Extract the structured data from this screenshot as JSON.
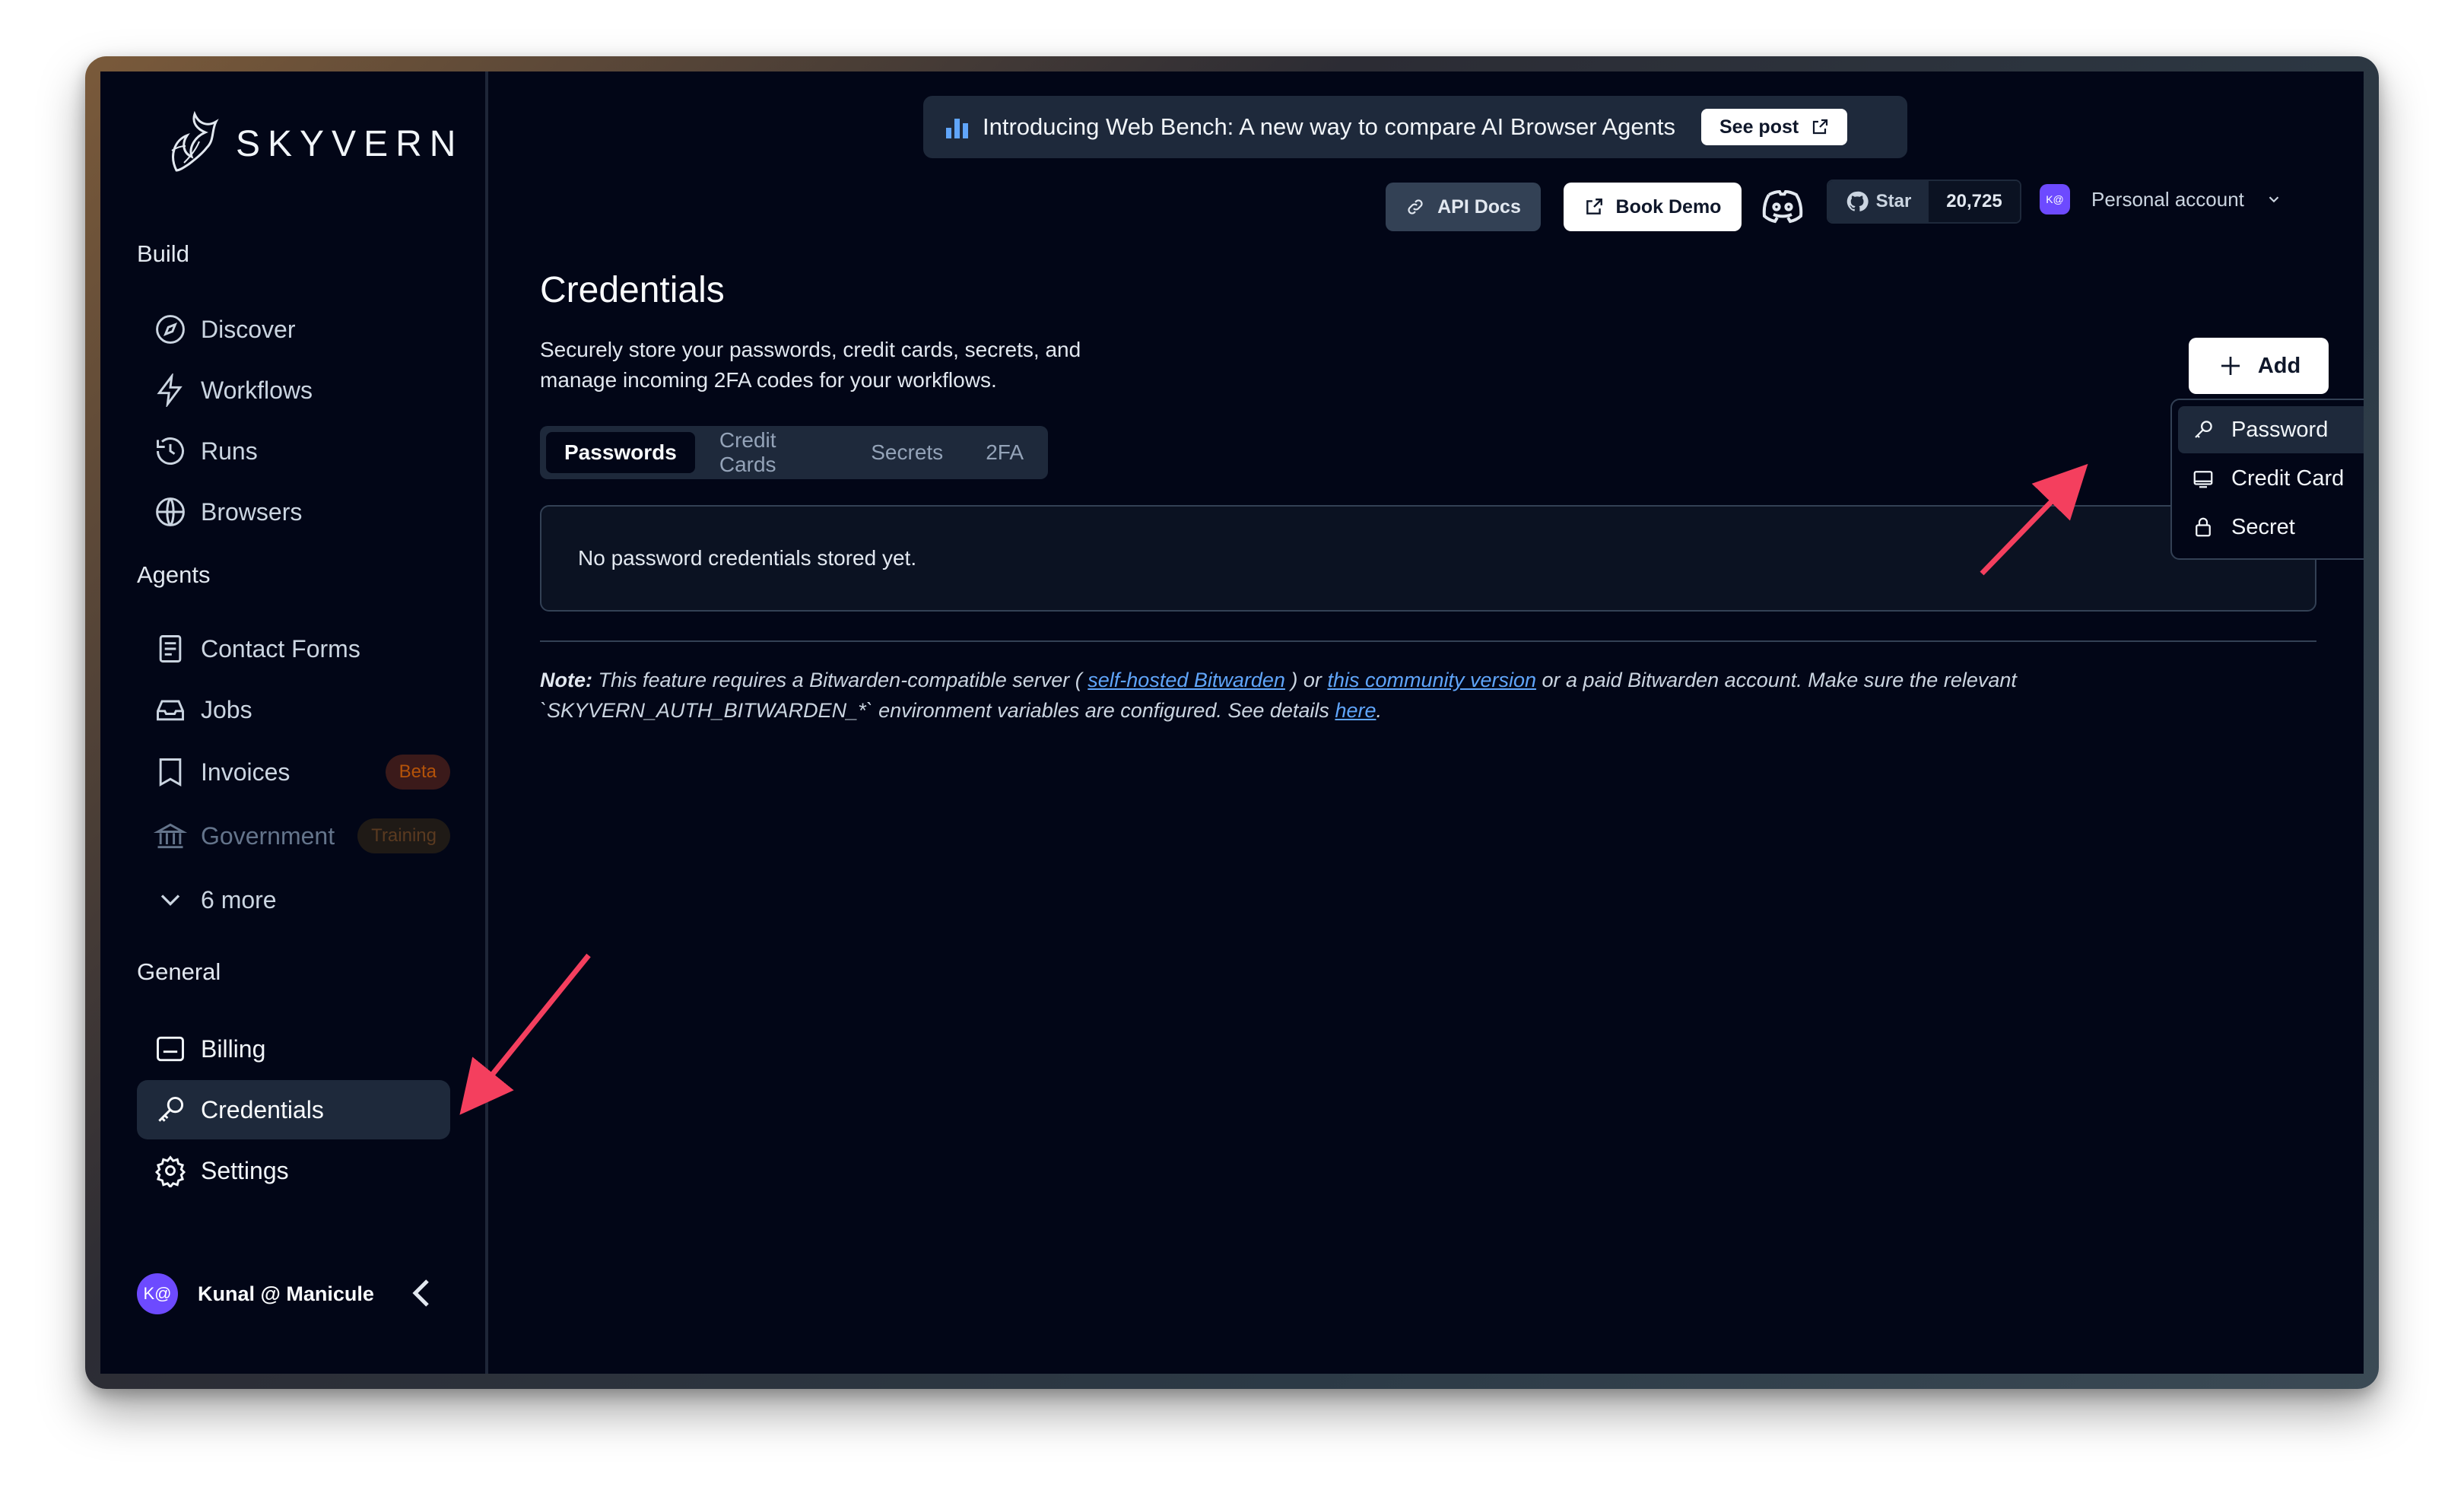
{
  "brand": {
    "name": "SKYVERN"
  },
  "sidebar": {
    "sections": [
      {
        "label": "Build"
      },
      {
        "label": "Agents"
      },
      {
        "label": "General"
      }
    ],
    "build_items": [
      {
        "label": "Discover",
        "icon": "compass-icon"
      },
      {
        "label": "Workflows",
        "icon": "lightning-icon"
      },
      {
        "label": "Runs",
        "icon": "history-icon"
      },
      {
        "label": "Browsers",
        "icon": "globe-icon"
      }
    ],
    "agent_items": [
      {
        "label": "Contact Forms",
        "icon": "form-icon"
      },
      {
        "label": "Jobs",
        "icon": "inbox-icon"
      },
      {
        "label": "Invoices",
        "icon": "bookmark-icon",
        "badge": "Beta"
      },
      {
        "label": "Government",
        "icon": "bank-icon",
        "badge": "Training"
      },
      {
        "label": "6 more",
        "icon": "chevron-down-icon"
      }
    ],
    "general_items": [
      {
        "label": "Billing",
        "icon": "billing-icon"
      },
      {
        "label": "Credentials",
        "icon": "key-icon",
        "active": true
      },
      {
        "label": "Settings",
        "icon": "gear-icon"
      }
    ],
    "user": {
      "initials": "K@",
      "name": "Kunal @ Manicule"
    }
  },
  "banner": {
    "text": "Introducing Web Bench: A new way to compare AI Browser Agents",
    "button": "See post"
  },
  "topbar": {
    "api_docs": "API Docs",
    "book_demo": "Book Demo",
    "github_star": "Star",
    "github_count": "20,725",
    "account_initials": "K@",
    "account_label": "Personal account"
  },
  "page": {
    "title": "Credentials",
    "description": "Securely store your passwords, credit cards, secrets, and manage incoming 2FA codes for your workflows.",
    "add_button": "Add",
    "tabs": [
      {
        "label": "Passwords",
        "active": true
      },
      {
        "label": "Credit Cards"
      },
      {
        "label": "Secrets"
      },
      {
        "label": "2FA"
      }
    ],
    "empty_message": "No password credentials stored yet.",
    "note": {
      "prefix": "Note:",
      "part1": " This feature requires a Bitwarden-compatible server ( ",
      "link1": "self-hosted Bitwarden",
      "part2": " ) or ",
      "link2": "this community version",
      "part3": " or a paid Bitwarden account. Make sure the relevant `SKYVERN_AUTH_BITWARDEN_*` environment variables are configured. See details ",
      "link3": "here",
      "part4": "."
    }
  },
  "dropdown": {
    "items": [
      {
        "label": "Password",
        "icon": "key-icon"
      },
      {
        "label": "Credit Card",
        "icon": "credit-card-icon"
      },
      {
        "label": "Secret",
        "icon": "lock-icon"
      }
    ]
  },
  "colors": {
    "background": "#020617",
    "panel": "#1e293b",
    "accent": "#6366f1",
    "arrow": "#f43f5e"
  }
}
